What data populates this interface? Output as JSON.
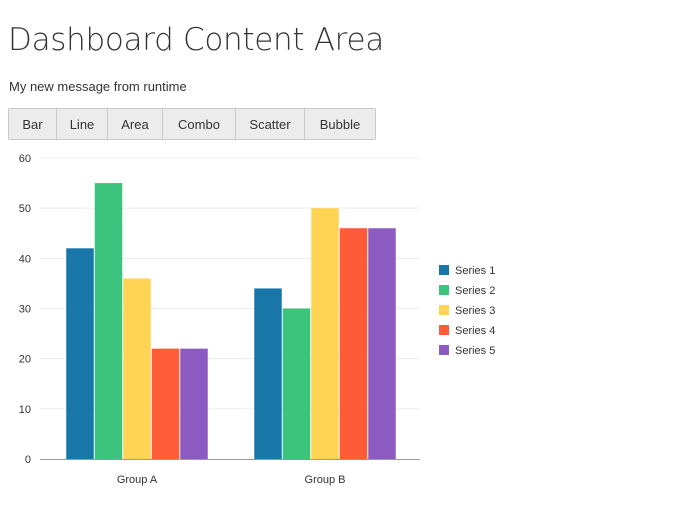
{
  "header": {
    "title": "Dashboard Content Area",
    "message": "My new message from runtime"
  },
  "toolbar": {
    "buttons": [
      {
        "label": "Bar"
      },
      {
        "label": "Line"
      },
      {
        "label": "Area"
      },
      {
        "label": "Combo"
      },
      {
        "label": "Scatter"
      },
      {
        "label": "Bubble"
      }
    ]
  },
  "chart_data": {
    "type": "bar",
    "categories": [
      "Group A",
      "Group B"
    ],
    "series": [
      {
        "name": "Series 1",
        "values": [
          42,
          34
        ],
        "color": "#1976a8"
      },
      {
        "name": "Series 2",
        "values": [
          55,
          30
        ],
        "color": "#3cc47c"
      },
      {
        "name": "Series 3",
        "values": [
          36,
          50
        ],
        "color": "#ffd455"
      },
      {
        "name": "Series 4",
        "values": [
          22,
          46
        ],
        "color": "#ff5b39"
      },
      {
        "name": "Series 5",
        "values": [
          22,
          46
        ],
        "color": "#8c5bc1"
      }
    ],
    "yticks": [
      0,
      10,
      20,
      30,
      40,
      50,
      60
    ],
    "ylim": [
      0,
      60
    ],
    "grid": true,
    "legend": "right"
  }
}
